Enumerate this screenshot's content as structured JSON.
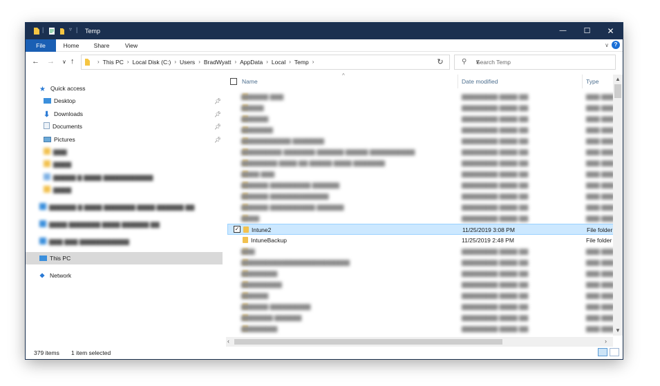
{
  "window": {
    "title": "Temp",
    "controls": {
      "minimize": "—",
      "maximize": "☐",
      "close": "✕"
    }
  },
  "ribbon": {
    "tabs": [
      "File",
      "Home",
      "Share",
      "View"
    ],
    "expand_icon": "chevron-down",
    "help_label": "?"
  },
  "address": {
    "path": [
      "This PC",
      "Local Disk (C:)",
      "Users",
      "BradWyatt",
      "AppData",
      "Local",
      "Temp"
    ],
    "search_placeholder": "Search Temp"
  },
  "nav_pane": {
    "quick_access_label": "Quick access",
    "pinned": [
      {
        "label": "Desktop",
        "icon": "desktop-icon"
      },
      {
        "label": "Downloads",
        "icon": "download-icon"
      },
      {
        "label": "Documents",
        "icon": "documents-icon"
      },
      {
        "label": "Pictures",
        "icon": "pictures-icon"
      }
    ],
    "this_pc_label": "This PC",
    "network_label": "Network"
  },
  "columns": {
    "name": "Name",
    "date_modified": "Date modified",
    "type": "Type"
  },
  "files": [
    {
      "name": "Intune2",
      "date": "11/25/2019 3:08 PM",
      "type": "File folder",
      "selected": true
    },
    {
      "name": "IntuneBackup",
      "date": "11/25/2019 2:48 PM",
      "type": "File folder",
      "selected": false
    }
  ],
  "status": {
    "item_count": "379 items",
    "selection": "1 item selected"
  },
  "colors": {
    "titlebar": "#1b3050",
    "file_tab": "#1a5fb4",
    "selection": "#cce8ff",
    "folder": "#f2c14e"
  }
}
